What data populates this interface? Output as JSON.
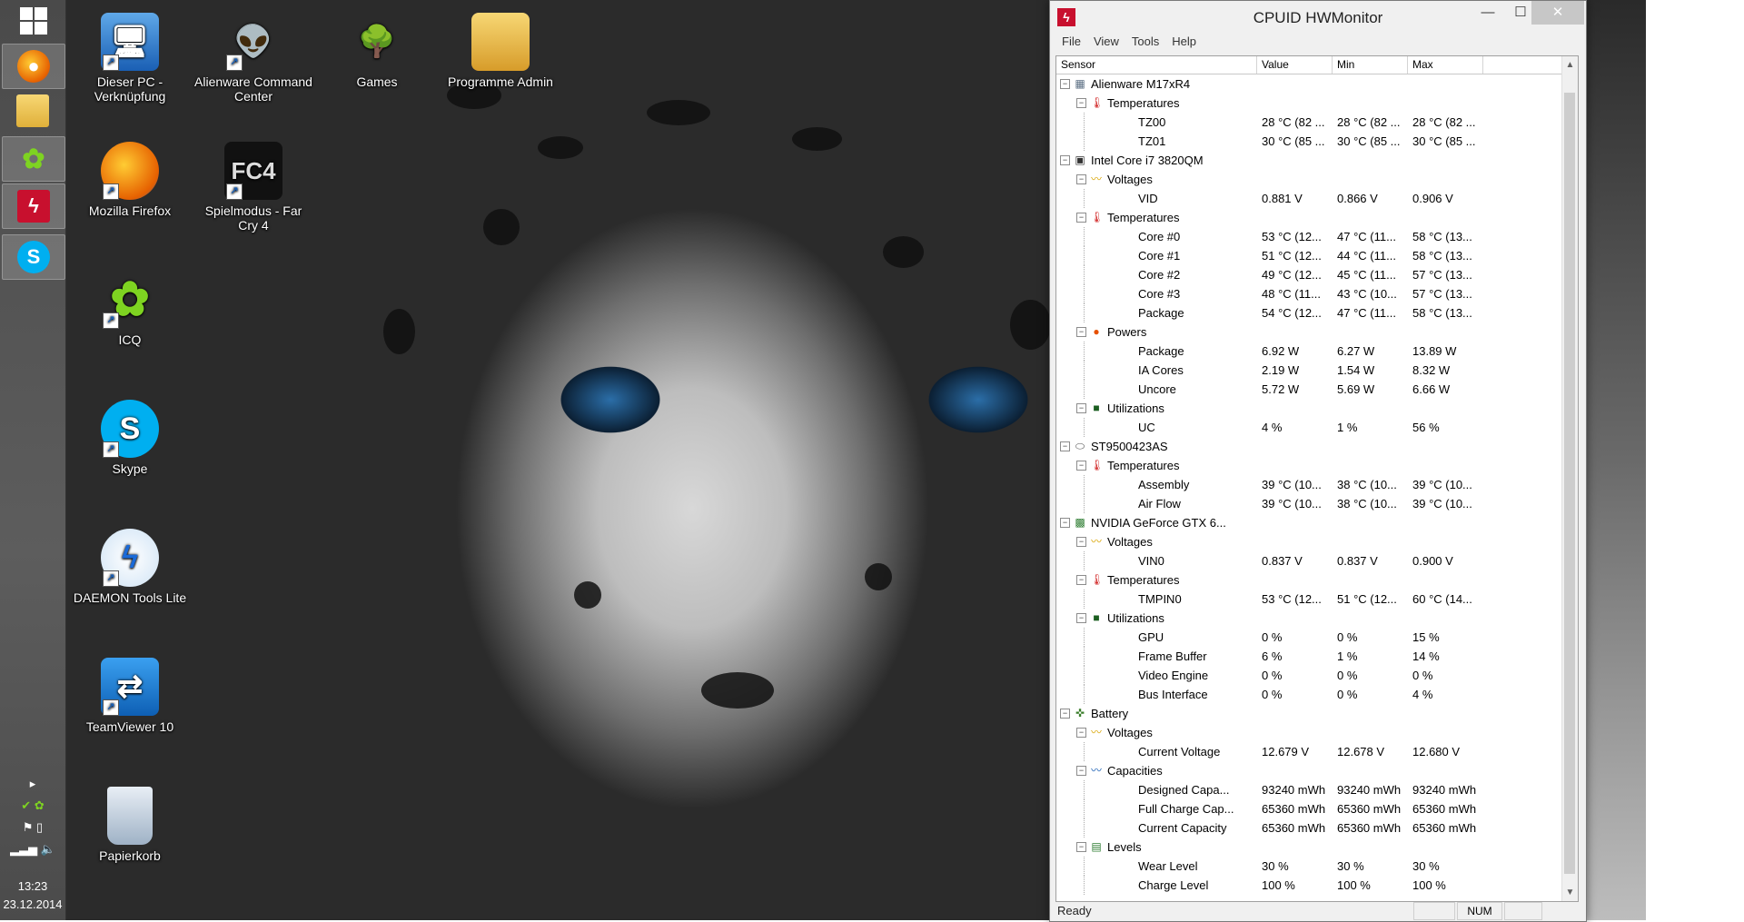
{
  "desktop_icons": [
    {
      "label": "Dieser PC - Verknüpfung",
      "icon": "computer-icon"
    },
    {
      "label": "Alienware Command Center",
      "icon": "alienware-icon"
    },
    {
      "label": "Games",
      "icon": "tree-icon"
    },
    {
      "label": "Programme Admin",
      "icon": "folder-icon"
    },
    {
      "label": "Mozilla Firefox",
      "icon": "firefox-icon"
    },
    {
      "label": "Spielmodus - Far Cry 4",
      "icon": "farcry4-icon"
    },
    {
      "label": "ICQ",
      "icon": "icq-icon"
    },
    {
      "label": "Skype",
      "icon": "skype-icon"
    },
    {
      "label": "DAEMON Tools Lite",
      "icon": "daemon-tools-icon"
    },
    {
      "label": "TeamViewer 10",
      "icon": "teamviewer-icon"
    },
    {
      "label": "Papierkorb",
      "icon": "recycle-bin-icon"
    }
  ],
  "taskbar": {
    "clock_time": "13:23",
    "clock_date": "23.12.2014",
    "pinned": [
      "firefox-icon",
      "file-explorer-icon",
      "icq-icon",
      "hwmonitor-icon",
      "skype-icon"
    ]
  },
  "window": {
    "title": "CPUID HWMonitor",
    "menu": [
      "File",
      "View",
      "Tools",
      "Help"
    ],
    "columns": {
      "sensor": "Sensor",
      "value": "Value",
      "min": "Min",
      "max": "Max"
    },
    "status": "Ready",
    "num_indicator": "NUM",
    "rows": [
      {
        "level": 0,
        "name": "Alienware M17xR4",
        "icon": "motherboard-icon",
        "expander": "−"
      },
      {
        "level": 1,
        "name": "Temperatures",
        "icon": "thermometer-icon",
        "expander": "−"
      },
      {
        "level": 2,
        "name": "TZ00",
        "value": "28 °C (82 ...",
        "min": "28 °C (82 ...",
        "max": "28 °C (82 ..."
      },
      {
        "level": 2,
        "name": "TZ01",
        "value": "30 °C (85 ...",
        "min": "30 °C (85 ...",
        "max": "30 °C (85 ..."
      },
      {
        "level": 0,
        "name": "Intel Core i7 3820QM",
        "icon": "cpu-icon",
        "expander": "−"
      },
      {
        "level": 1,
        "name": "Voltages",
        "icon": "voltage-icon",
        "expander": "−"
      },
      {
        "level": 2,
        "name": "VID",
        "value": "0.881 V",
        "min": "0.866 V",
        "max": "0.906 V"
      },
      {
        "level": 1,
        "name": "Temperatures",
        "icon": "thermometer-icon",
        "expander": "−"
      },
      {
        "level": 2,
        "name": "Core #0",
        "value": "53 °C (12...",
        "min": "47 °C (11...",
        "max": "58 °C (13..."
      },
      {
        "level": 2,
        "name": "Core #1",
        "value": "51 °C (12...",
        "min": "44 °C (11...",
        "max": "58 °C (13..."
      },
      {
        "level": 2,
        "name": "Core #2",
        "value": "49 °C (12...",
        "min": "45 °C (11...",
        "max": "57 °C (13..."
      },
      {
        "level": 2,
        "name": "Core #3",
        "value": "48 °C (11...",
        "min": "43 °C (10...",
        "max": "57 °C (13..."
      },
      {
        "level": 2,
        "name": "Package",
        "value": "54 °C (12...",
        "min": "47 °C (11...",
        "max": "58 °C (13..."
      },
      {
        "level": 1,
        "name": "Powers",
        "icon": "power-icon",
        "expander": "−"
      },
      {
        "level": 2,
        "name": "Package",
        "value": "6.92 W",
        "min": "6.27 W",
        "max": "13.89 W"
      },
      {
        "level": 2,
        "name": "IA Cores",
        "value": "2.19 W",
        "min": "1.54 W",
        "max": "8.32 W"
      },
      {
        "level": 2,
        "name": "Uncore",
        "value": "5.72 W",
        "min": "5.69 W",
        "max": "6.66 W"
      },
      {
        "level": 1,
        "name": "Utilizations",
        "icon": "utilization-icon",
        "expander": "−"
      },
      {
        "level": 2,
        "name": "UC",
        "value": "4 %",
        "min": "1 %",
        "max": "56 %"
      },
      {
        "level": 0,
        "name": "ST9500423AS",
        "icon": "disk-icon",
        "expander": "−"
      },
      {
        "level": 1,
        "name": "Temperatures",
        "icon": "thermometer-icon",
        "expander": "−"
      },
      {
        "level": 2,
        "name": "Assembly",
        "value": "39 °C (10...",
        "min": "38 °C (10...",
        "max": "39 °C (10..."
      },
      {
        "level": 2,
        "name": "Air Flow",
        "value": "39 °C (10...",
        "min": "38 °C (10...",
        "max": "39 °C (10..."
      },
      {
        "level": 0,
        "name": "NVIDIA GeForce GTX 6...",
        "icon": "gpu-icon",
        "expander": "−"
      },
      {
        "level": 1,
        "name": "Voltages",
        "icon": "voltage-icon",
        "expander": "−"
      },
      {
        "level": 2,
        "name": "VIN0",
        "value": "0.837 V",
        "min": "0.837 V",
        "max": "0.900 V"
      },
      {
        "level": 1,
        "name": "Temperatures",
        "icon": "thermometer-icon",
        "expander": "−"
      },
      {
        "level": 2,
        "name": "TMPIN0",
        "value": "53 °C (12...",
        "min": "51 °C (12...",
        "max": "60 °C (14..."
      },
      {
        "level": 1,
        "name": "Utilizations",
        "icon": "utilization-icon",
        "expander": "−"
      },
      {
        "level": 2,
        "name": "GPU",
        "value": "0 %",
        "min": "0 %",
        "max": "15 %"
      },
      {
        "level": 2,
        "name": "Frame Buffer",
        "value": "6 %",
        "min": "1 %",
        "max": "14 %"
      },
      {
        "level": 2,
        "name": "Video Engine",
        "value": "0 %",
        "min": "0 %",
        "max": "0 %"
      },
      {
        "level": 2,
        "name": "Bus Interface",
        "value": "0 %",
        "min": "0 %",
        "max": "4 %"
      },
      {
        "level": 0,
        "name": "Battery",
        "icon": "battery-icon",
        "expander": "−"
      },
      {
        "level": 1,
        "name": "Voltages",
        "icon": "voltage-icon",
        "expander": "−"
      },
      {
        "level": 2,
        "name": "Current Voltage",
        "value": "12.679 V",
        "min": "12.678 V",
        "max": "12.680 V"
      },
      {
        "level": 1,
        "name": "Capacities",
        "icon": "capacity-icon",
        "expander": "−"
      },
      {
        "level": 2,
        "name": "Designed Capa...",
        "value": "93240 mWh",
        "min": "93240 mWh",
        "max": "93240 mWh"
      },
      {
        "level": 2,
        "name": "Full Charge Cap...",
        "value": "65360 mWh",
        "min": "65360 mWh",
        "max": "65360 mWh"
      },
      {
        "level": 2,
        "name": "Current Capacity",
        "value": "65360 mWh",
        "min": "65360 mWh",
        "max": "65360 mWh"
      },
      {
        "level": 1,
        "name": "Levels",
        "icon": "levels-icon",
        "expander": "−"
      },
      {
        "level": 2,
        "name": "Wear Level",
        "value": "30 %",
        "min": "30 %",
        "max": "30 %"
      },
      {
        "level": 2,
        "name": "Charge Level",
        "value": "100 %",
        "min": "100 %",
        "max": "100 %"
      }
    ]
  }
}
